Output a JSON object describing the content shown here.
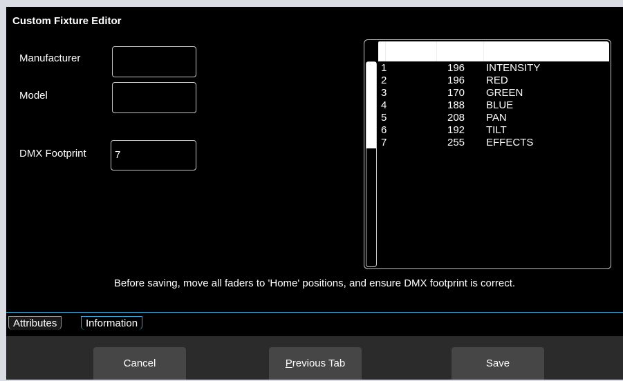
{
  "window": {
    "title": "Custom Fixture Editor"
  },
  "form": {
    "manufacturer_label": "Manufacturer",
    "manufacturer_value": "",
    "model_label": "Model",
    "model_value": "",
    "dmx_footprint_label": "DMX Footprint",
    "dmx_footprint_value": "7"
  },
  "channels": [
    {
      "num": "1",
      "value": "196",
      "name": "INTENSITY"
    },
    {
      "num": "2",
      "value": "196",
      "name": "RED"
    },
    {
      "num": "3",
      "value": "170",
      "name": "GREEN"
    },
    {
      "num": "4",
      "value": "188",
      "name": "BLUE"
    },
    {
      "num": "5",
      "value": "208",
      "name": "PAN"
    },
    {
      "num": "6",
      "value": "192",
      "name": "TILT"
    },
    {
      "num": "7",
      "value": "255",
      "name": "EFFECTS"
    }
  ],
  "info_text": "Before saving, move all faders to 'Home' positions, and ensure DMX footprint is correct.",
  "tabs": [
    {
      "label": "Attributes",
      "active": false
    },
    {
      "label": "Information",
      "active": true
    }
  ],
  "buttons": {
    "cancel": "Cancel",
    "previous_tab_mnemonic": "P",
    "previous_tab_rest": "revious Tab",
    "save": "Save"
  },
  "colors": {
    "accent": "#3aa6d8",
    "background": "#000000",
    "footer": "#2b2b2b",
    "button": "#464646"
  }
}
